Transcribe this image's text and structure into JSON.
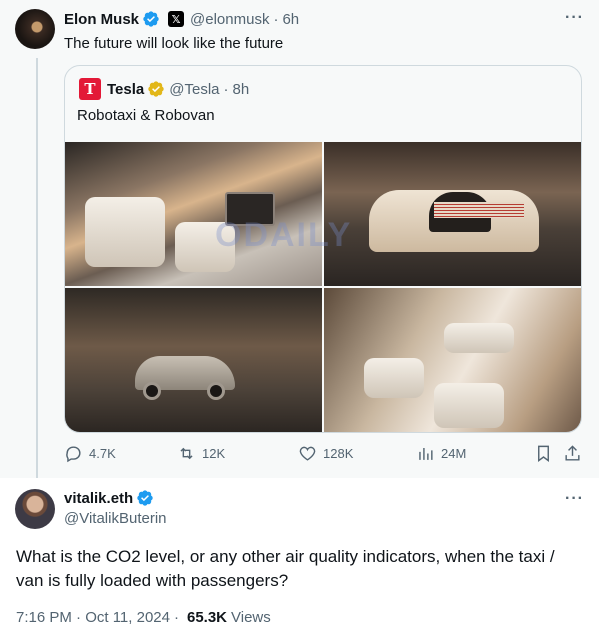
{
  "top_tweet": {
    "author_name": "Elon Musk",
    "author_handle": "@elonmusk",
    "separator": "·",
    "time": "6h",
    "text": "The future will look like the future",
    "more_icon": "more-icon"
  },
  "quoted_tweet": {
    "author_name": "Tesla",
    "author_handle": "@Tesla",
    "separator": "·",
    "time": "8h",
    "text": "Robotaxi & Robovan",
    "avatar_letter": "T",
    "brand_color": "#e31937"
  },
  "watermark": "ODAILY",
  "actions": {
    "replies": "4.7K",
    "reposts": "12K",
    "likes": "128K",
    "views": "24M"
  },
  "reply_tweet": {
    "author_name": "vitalik.eth",
    "author_handle": "@VitalikButerin",
    "text": "What is the CO2 level, or any other air quality indicators, when the taxi / van is fully loaded with passengers?",
    "timestamp": "7:16 PM · Oct 11, 2024",
    "separator": "·",
    "views_count": "65.3K",
    "views_label": "Views"
  },
  "colors": {
    "verified_blue": "#1d9bf0",
    "verified_gold": "#e2b719",
    "secondary_text": "#536471",
    "primary_text": "#0f1419"
  }
}
